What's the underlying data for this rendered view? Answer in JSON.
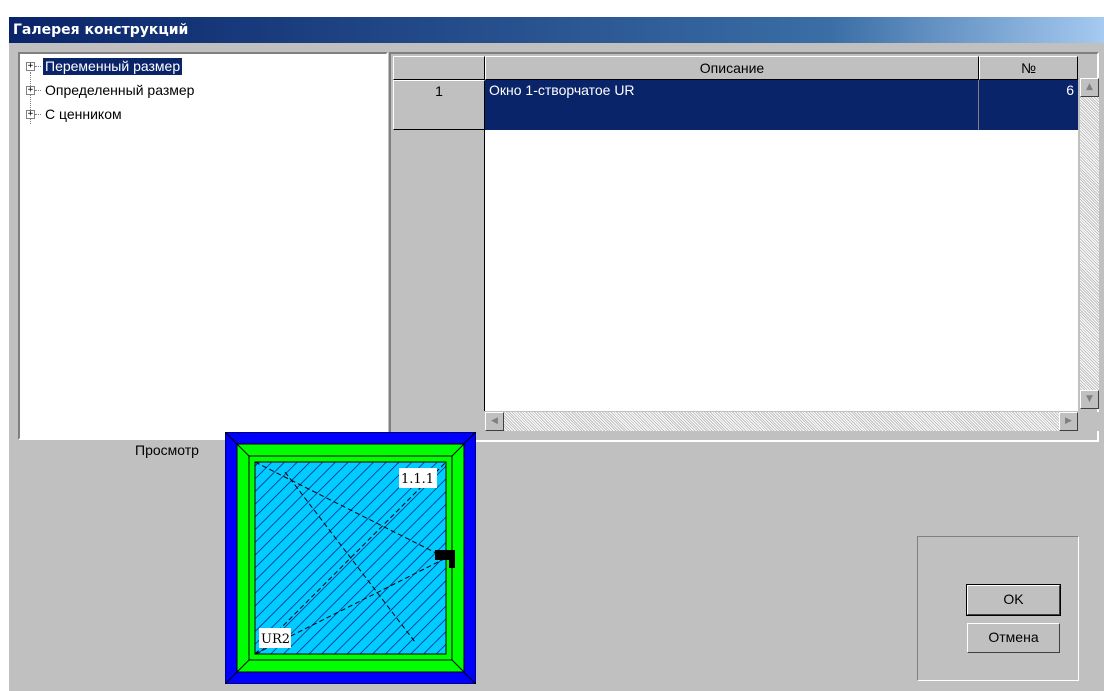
{
  "window": {
    "title": "Галерея конструкций"
  },
  "tree": {
    "items": [
      {
        "label": "Переменный размер",
        "selected": true,
        "expander": "+"
      },
      {
        "label": "Определенный размер",
        "selected": false,
        "expander": "+"
      },
      {
        "label": "С ценником",
        "selected": false,
        "expander": "+"
      }
    ]
  },
  "grid": {
    "columns": [
      "",
      "Описание",
      "№"
    ],
    "rows": [
      {
        "row_number": "1",
        "description": "Окно 1-створчатое UR",
        "number": "6",
        "selected": true
      }
    ]
  },
  "preview": {
    "label": "Просмотр",
    "sash_label": "1.1.1",
    "type_label": "UR2"
  },
  "buttons": {
    "ok": "OK",
    "cancel": "Отмена"
  },
  "colors": {
    "title_start": "#0a246a",
    "selection": "#0a246a",
    "frame_blue": "#0000ff",
    "frame_green": "#00ff00",
    "glass_cyan": "#00ccff",
    "dialog_bg": "#c0c0c0"
  }
}
